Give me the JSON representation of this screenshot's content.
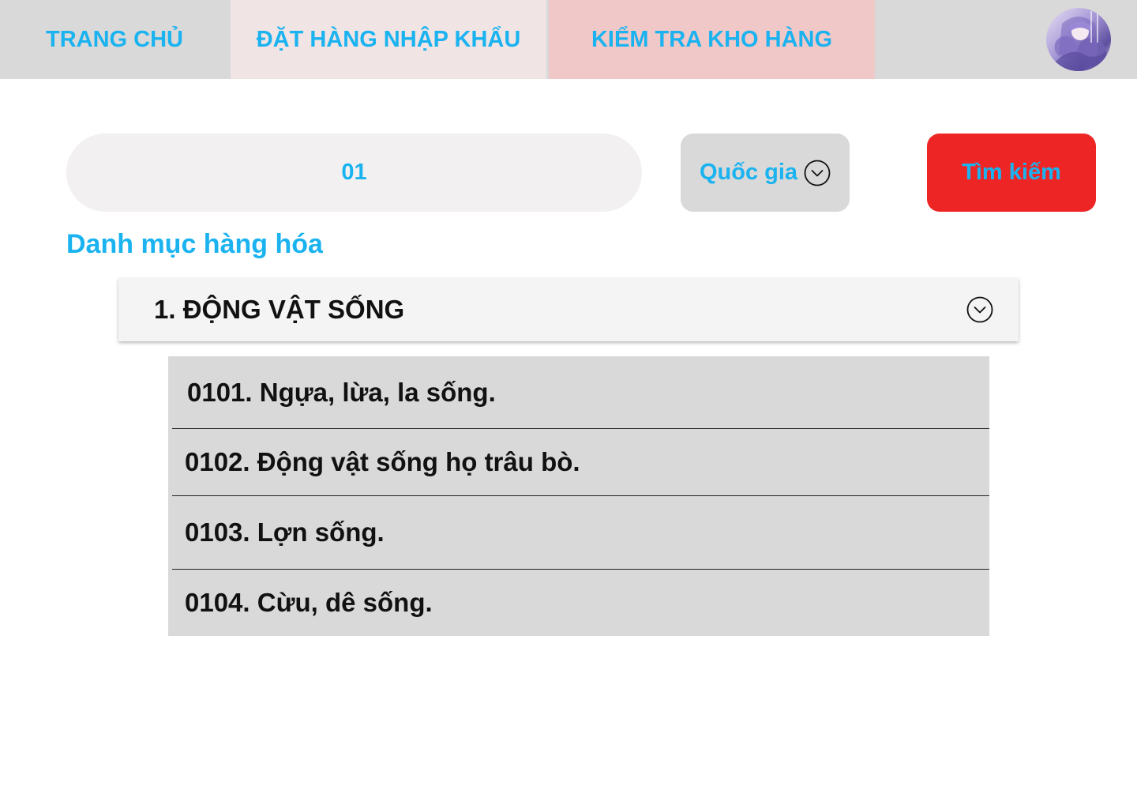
{
  "nav": {
    "tabs": [
      {
        "label": "TRANG CHỦ"
      },
      {
        "label": "ĐẶT HÀNG NHẬP KHẨU"
      },
      {
        "label": "KIỂM TRA KHO HÀNG"
      }
    ]
  },
  "user": {
    "avatar_icon": "anime-avatar-icon"
  },
  "search": {
    "value": "01"
  },
  "country": {
    "label": "Quốc gia",
    "icon": "chevron-down-circle-icon"
  },
  "search_button": {
    "label": "Tìm kiếm"
  },
  "catalog": {
    "title": "Danh mục hàng hóa",
    "category": {
      "title": "1. ĐỘNG VẬT SỐNG",
      "icon": "chevron-down-circle-icon"
    },
    "items": [
      {
        "label": "0101. Ngựa, lừa, la sống."
      },
      {
        "label": "0102. Động vật sống họ trâu bò."
      },
      {
        "label": "0103. Lợn sống."
      },
      {
        "label": "0104. Cừu, dê sống."
      }
    ]
  },
  "colors": {
    "accent": "#1ab3f0",
    "nav_bg": "#d9d9d9",
    "tab_active_bg": "#f0e4e4",
    "tab_highlight_bg": "#f0c8c8",
    "search_button_bg": "#ee2525",
    "list_bg": "#d9d9d9"
  }
}
